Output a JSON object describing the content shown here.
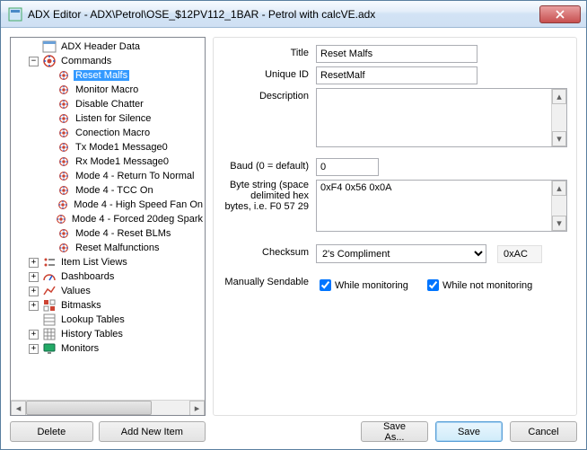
{
  "window": {
    "title": "ADX Editor - ADX\\Petrol\\OSE_$12PV112_1BAR - Petrol with calcVE.adx"
  },
  "tree": {
    "root": [
      {
        "label": "ADX Header Data",
        "icon": "header-icon",
        "expander": "none"
      },
      {
        "label": "Commands",
        "icon": "commands-icon",
        "expander": "minus",
        "children": [
          {
            "label": "Reset Malfs",
            "selected": true
          },
          {
            "label": "Monitor Macro"
          },
          {
            "label": "Disable Chatter"
          },
          {
            "label": "Listen for Silence"
          },
          {
            "label": "Conection Macro"
          },
          {
            "label": "Tx Mode1 Message0"
          },
          {
            "label": "Rx Mode1 Message0"
          },
          {
            "label": "Mode 4 - Return To Normal"
          },
          {
            "label": "Mode 4 - TCC On"
          },
          {
            "label": "Mode 4 - High Speed Fan On"
          },
          {
            "label": "Mode 4 - Forced 20deg Spark"
          },
          {
            "label": "Mode 4 - Reset BLMs"
          },
          {
            "label": "Reset Malfunctions"
          }
        ]
      },
      {
        "label": "Item List Views",
        "icon": "listview-icon",
        "expander": "plus"
      },
      {
        "label": "Dashboards",
        "icon": "dashboard-icon",
        "expander": "plus"
      },
      {
        "label": "Values",
        "icon": "values-icon",
        "expander": "plus"
      },
      {
        "label": "Bitmasks",
        "icon": "bitmask-icon",
        "expander": "plus"
      },
      {
        "label": "Lookup Tables",
        "icon": "lookup-icon",
        "expander": "none"
      },
      {
        "label": "History Tables",
        "icon": "history-icon",
        "expander": "plus"
      },
      {
        "label": "Monitors",
        "icon": "monitor-icon",
        "expander": "plus"
      }
    ]
  },
  "leftButtons": {
    "delete": "Delete",
    "addNew": "Add New Item"
  },
  "form": {
    "titleLabel": "Title",
    "titleValue": "Reset Malfs",
    "uniqueIdLabel": "Unique ID",
    "uniqueIdValue": "ResetMalf",
    "descriptionLabel": "Description",
    "descriptionValue": "",
    "baudLabel": "Baud (0 = default)",
    "baudValue": "0",
    "byteStringLabel": "Byte string (space delimited hex bytes, i.e. F0 57 29",
    "byteStringValue": "0xF4 0x56 0x0A",
    "checksumLabel": "Checksum",
    "checksumOptions": [
      "2's Compliment"
    ],
    "checksumSelected": "2's Compliment",
    "checksumResult": "0xAC",
    "manuallySendableLabel": "Manually Sendable",
    "whileMonitoringLabel": "While monitoring",
    "whileMonitoringChecked": true,
    "whileNotMonitoringLabel": "While not monitoring",
    "whileNotMonitoringChecked": true
  },
  "rightButtons": {
    "saveAs": "Save As...",
    "save": "Save",
    "cancel": "Cancel"
  }
}
